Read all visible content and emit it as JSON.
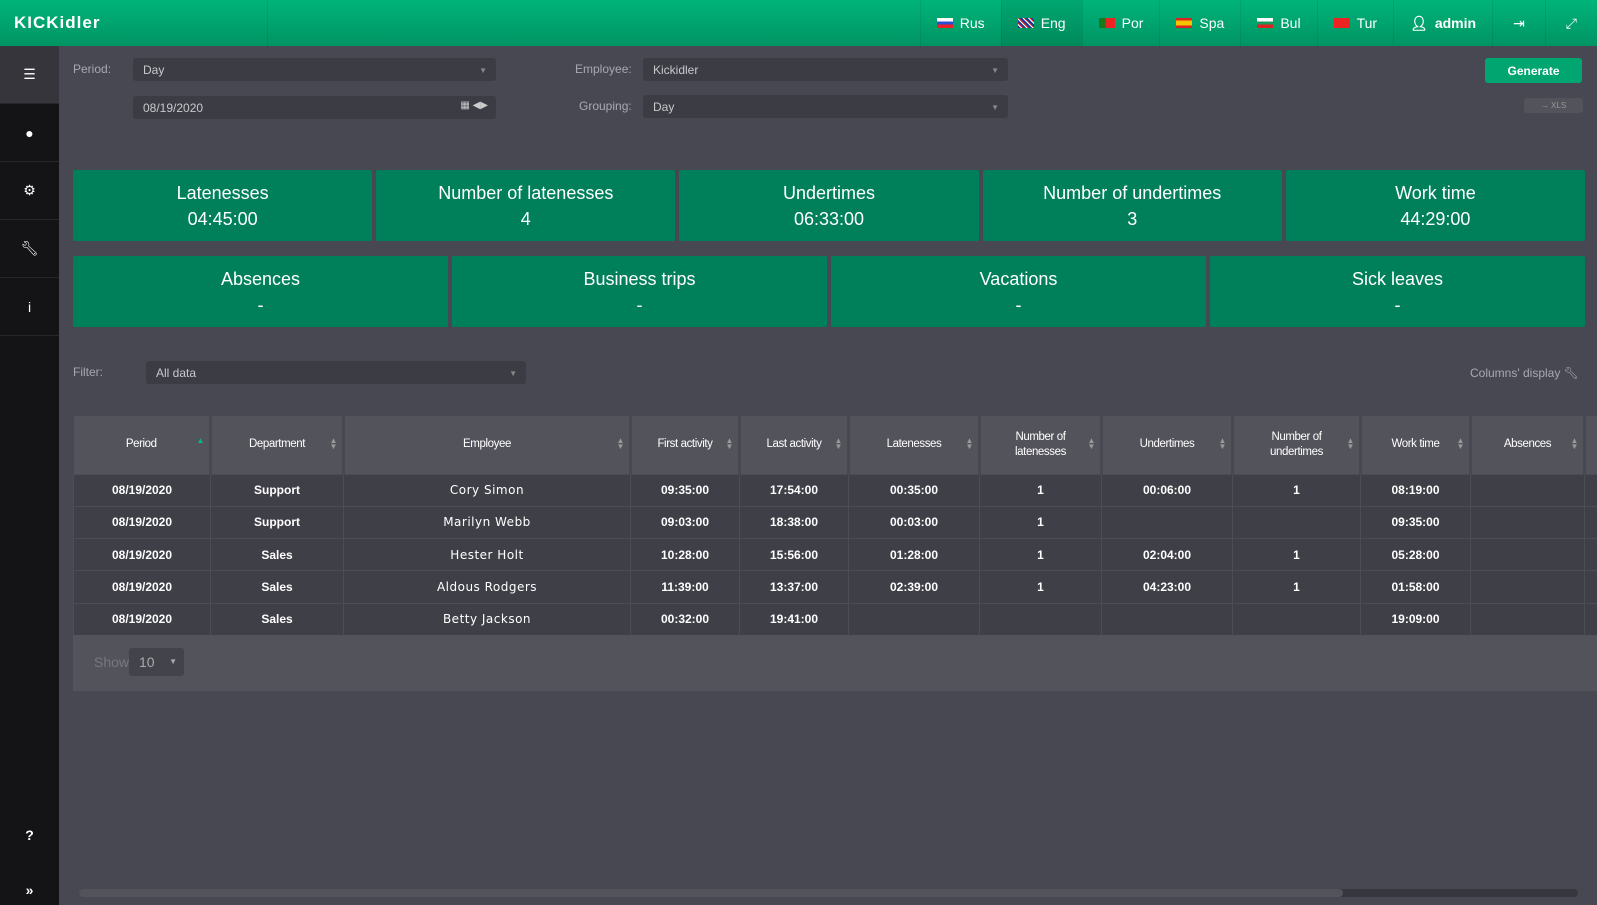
{
  "app": {
    "logo": "KICKidler"
  },
  "topnav": {
    "languages": [
      {
        "code": "Rus",
        "flag": "ru"
      },
      {
        "code": "Eng",
        "flag": "gb",
        "active": true
      },
      {
        "code": "Por",
        "flag": "pt"
      },
      {
        "code": "Spa",
        "flag": "es"
      },
      {
        "code": "Bul",
        "flag": "bg"
      },
      {
        "code": "Tur",
        "flag": "tr"
      }
    ],
    "user": "admin"
  },
  "sidebar": {
    "items": [
      "menu-icon",
      "user-icon",
      "gears-icon",
      "wrench-icon",
      "info-icon"
    ],
    "help": "?",
    "expand": "»"
  },
  "filters": {
    "period_label": "Period:",
    "period_value": "Day",
    "date_value": "08/19/2020",
    "employee_label": "Employee:",
    "employee_value": "Kickidler",
    "grouping_label": "Grouping:",
    "grouping_value": "Day",
    "generate": "Generate",
    "xls": "→ XLS"
  },
  "summary": [
    {
      "title": "Latenesses",
      "value": "04:45:00"
    },
    {
      "title": "Number of latenesses",
      "value": "4"
    },
    {
      "title": "Undertimes",
      "value": "06:33:00"
    },
    {
      "title": "Number of undertimes",
      "value": "3"
    },
    {
      "title": "Work time",
      "value": "44:29:00"
    }
  ],
  "summary2": [
    {
      "title": "Absences",
      "value": "-"
    },
    {
      "title": "Business trips",
      "value": "-"
    },
    {
      "title": "Vacations",
      "value": "-"
    },
    {
      "title": "Sick leaves",
      "value": "-"
    }
  ],
  "filter": {
    "label": "Filter:",
    "value": "All data",
    "columns_display": "Columns' display"
  },
  "table": {
    "headers": [
      "Period",
      "Department",
      "Employee",
      "First activity",
      "Last activity",
      "Latenesses",
      "Number of latenesses",
      "Undertimes",
      "Number of undertimes",
      "Work time",
      "Absences"
    ],
    "rows": [
      [
        "08/19/2020",
        "Support",
        "Cory Simon",
        "09:35:00",
        "17:54:00",
        "00:35:00",
        "1",
        "00:06:00",
        "1",
        "08:19:00",
        ""
      ],
      [
        "08/19/2020",
        "Support",
        "Marilyn Webb",
        "09:03:00",
        "18:38:00",
        "00:03:00",
        "1",
        "",
        "",
        "09:35:00",
        ""
      ],
      [
        "08/19/2020",
        "Sales",
        "Hester Holt",
        "10:28:00",
        "15:56:00",
        "01:28:00",
        "1",
        "02:04:00",
        "1",
        "05:28:00",
        ""
      ],
      [
        "08/19/2020",
        "Sales",
        "Aldous Rodgers",
        "11:39:00",
        "13:37:00",
        "02:39:00",
        "1",
        "04:23:00",
        "1",
        "01:58:00",
        ""
      ],
      [
        "08/19/2020",
        "Sales",
        "Betty Jackson",
        "00:32:00",
        "19:41:00",
        "",
        "",
        "",
        "",
        "19:09:00",
        ""
      ]
    ]
  },
  "pagination": {
    "show_label": "Show",
    "page_size": "10"
  },
  "colors": {
    "accent": "#00a570",
    "card": "#00805a",
    "background": "#484852",
    "sidebar": "#141417"
  }
}
